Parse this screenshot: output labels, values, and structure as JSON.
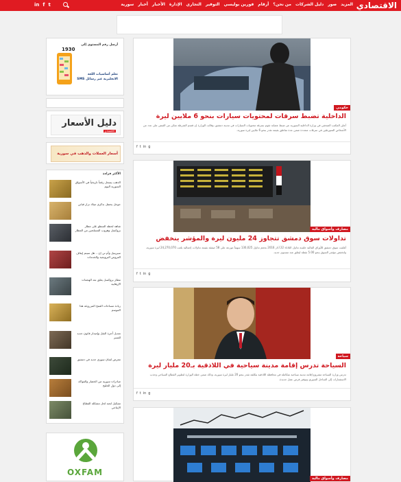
{
  "header": {
    "logo": "الاقتصادي",
    "nav": [
      "سورية",
      "أخبار",
      "الأخبار",
      "الإدارة",
      "التجاري",
      "التوفير",
      "فورين بوليسي",
      "أرقام",
      "من نحن؟",
      "دليل الشركات",
      "صور",
      "المزيد"
    ],
    "social": [
      "in",
      "f",
      "t"
    ]
  },
  "sidebar": {
    "promo_number": "1930",
    "promo_line1": "أرسل رقم المستوى إلى",
    "promo_line2": "تعلم أساسيات اللغة",
    "promo_line3": "الانجليزية عبر رسائل SMS",
    "price_guide": "دليل الأسعار",
    "price_guide_sub": "الاقتصادي",
    "currency_banner": "أسعار العملات والذهب في سورية",
    "popular_title": "الأكثر قراءة",
    "popular": [
      "الذهب يسجل رقماً تاريخياً في الأسواق السورية اليوم",
      "جوجل يحتفل بذكرى ميلاد نزار قباني",
      "شاهد لحظة السطو على مطار بروكسل وهروب المسلحين من المطار",
      "سيريتيل وأم تي إن .. هل سيتم إيقاف العروض الترويجية والخدمات",
      "مطار بروكسل يغلق بعد الهجمات الإرهابية",
      "زيادة مساحات القمح المزروعة هذا الموسم",
      "تعديل أجرة النقل وإصدار قانون جديد للسير",
      "معرض لفنان سوري جديد في دمشق",
      "صادرات سورية من الخضار والفواكه إلى دول الخليج",
      "تشكيل لجنة لحل مشكلة القطاع الإنتاجي"
    ],
    "oxfam": "OXFAM"
  },
  "articles": [
    {
      "category": "حكومي",
      "title": "الداخلية تضبط سرقات لمحتويات سيارات بنحو 6 ملايين ليرة",
      "excerpt": "أعلن المكتب الصحفي في وزارة الداخلية السورية عن ضبط عصابة تقوم بسرقة محتويات السيارات في مدينة دمشق، وقالت الوزارة إن قسم الشرطة تمكن من القبض على عدد من الأشخاص المتورطين في سرقات متعددة ضمن عدة مناطق بقيمة تقدر بنحو 6 ملايين ليرة سورية."
    },
    {
      "category": "مصارف وأسواق مالية",
      "title": "تداولات سوق دمشق تتجاوز 24 مليون ليرة والمؤشر ينخفض",
      "excerpt": "أغلقت سوق دمشق للأوراق المالية جلسة تداول الثلاثاء 22 آذار 2016 بحجم تداول 130,025 سهماً موزعة على 58 صفقة بقيمة تداولات إجمالية بلغت 24,270,070 ليرة سورية، وانخفض مؤشر السوق بنحو 5.00 نقطة ليغلق عند مستوى جديد."
    },
    {
      "category": "سياحة",
      "title": "السياحة تدرس إقامة مدينة سياحية في اللاذقية بـ20 مليار ليرة",
      "excerpt": "تدرس وزارة السياحة مشروع إقامة مدينة سياحية متكاملة في محافظة اللاذقية بتكلفة تقدر بنحو 20 مليار ليرة سورية، وذلك ضمن خطة الوزارة لتطوير القطاع السياحي وجذب الاستثمارات إلى الساحل السوري وتوفير فرص عمل جديدة."
    },
    {
      "category": "مصارف وأسواق مالية",
      "title": "",
      "excerpt": ""
    }
  ]
}
